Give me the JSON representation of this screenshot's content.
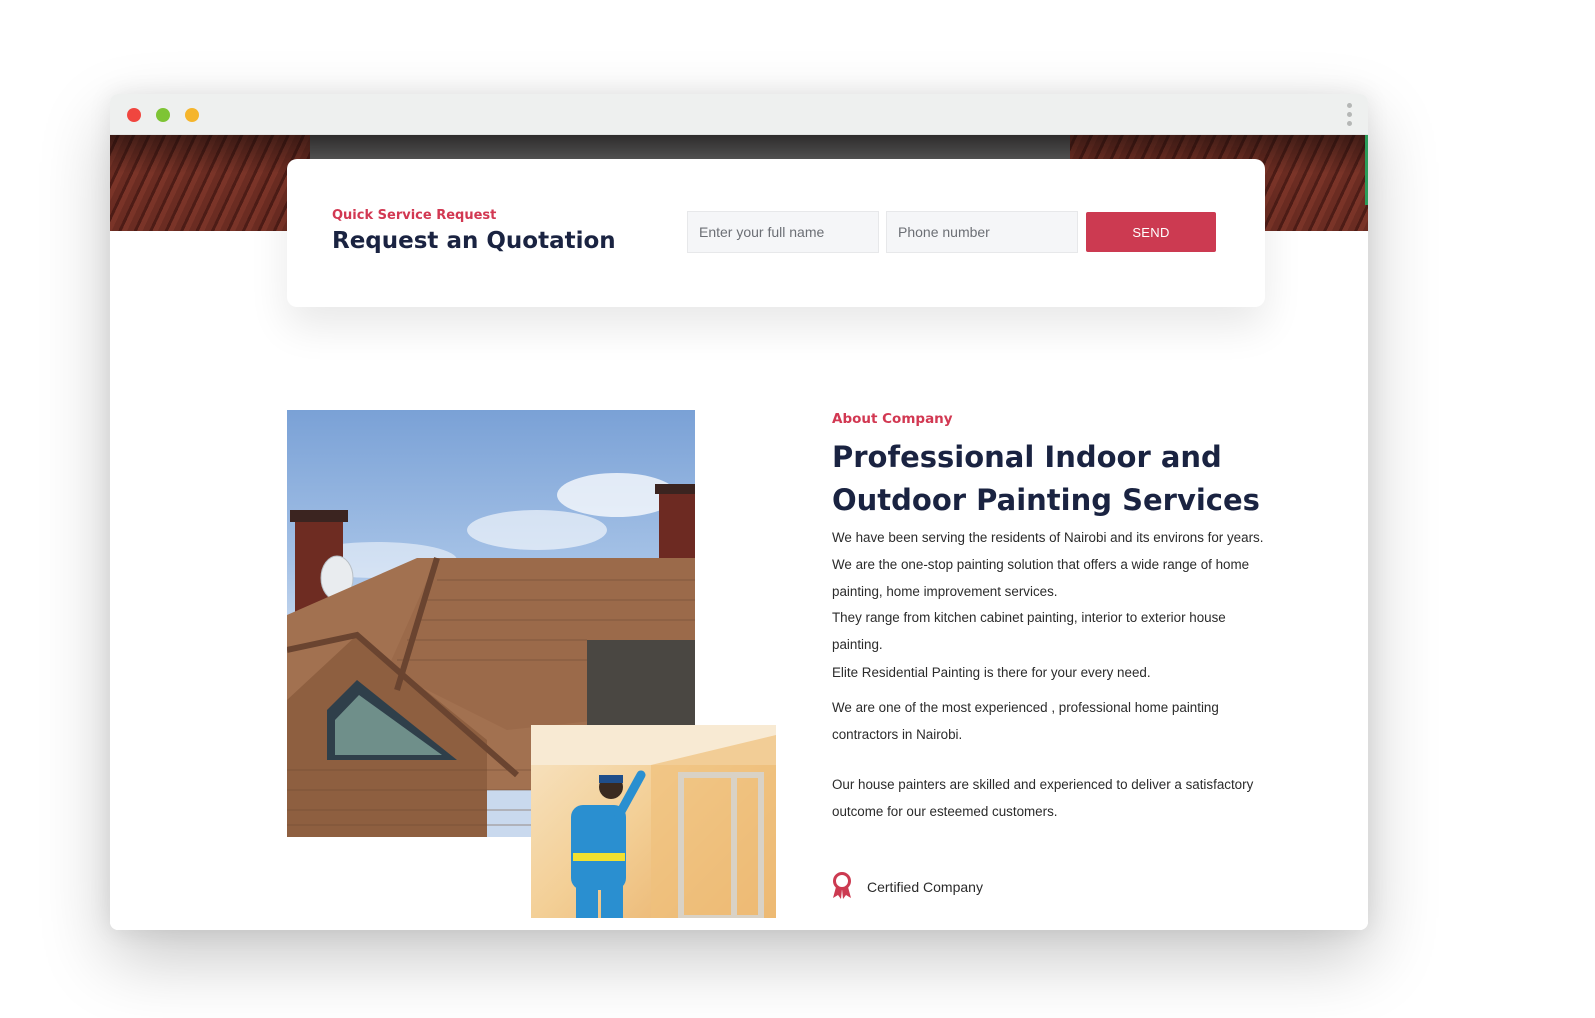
{
  "colors": {
    "accent": "#cc3a51",
    "heading": "#1a2341"
  },
  "window": {
    "controls": [
      "close",
      "minimize",
      "maximize"
    ],
    "menu_icon": "more-vertical-icon"
  },
  "quote": {
    "subtitle": "Quick Service Request",
    "title": "Request an Quotation",
    "name_placeholder": "Enter your full name",
    "phone_placeholder": "Phone number",
    "send_label": "SEND"
  },
  "about": {
    "subtitle": "About Company",
    "title": "Professional Indoor and Outdoor Painting Services",
    "paragraphs": [
      "We have been serving the residents of Nairobi and its environs for years. We are the one-stop painting solution that offers a wide range of home painting, home improvement services.",
      "They range from kitchen cabinet painting, interior to exterior house painting.",
      "Elite Residential Painting is there for your every need.",
      "We are one of the most experienced , professional home painting contractors in Nairobi.",
      "Our house painters are skilled and experienced to deliver a satisfactory outcome for our esteemed customers."
    ],
    "certified_label": "Certified Company",
    "certified_icon": "award-ribbon-icon"
  }
}
